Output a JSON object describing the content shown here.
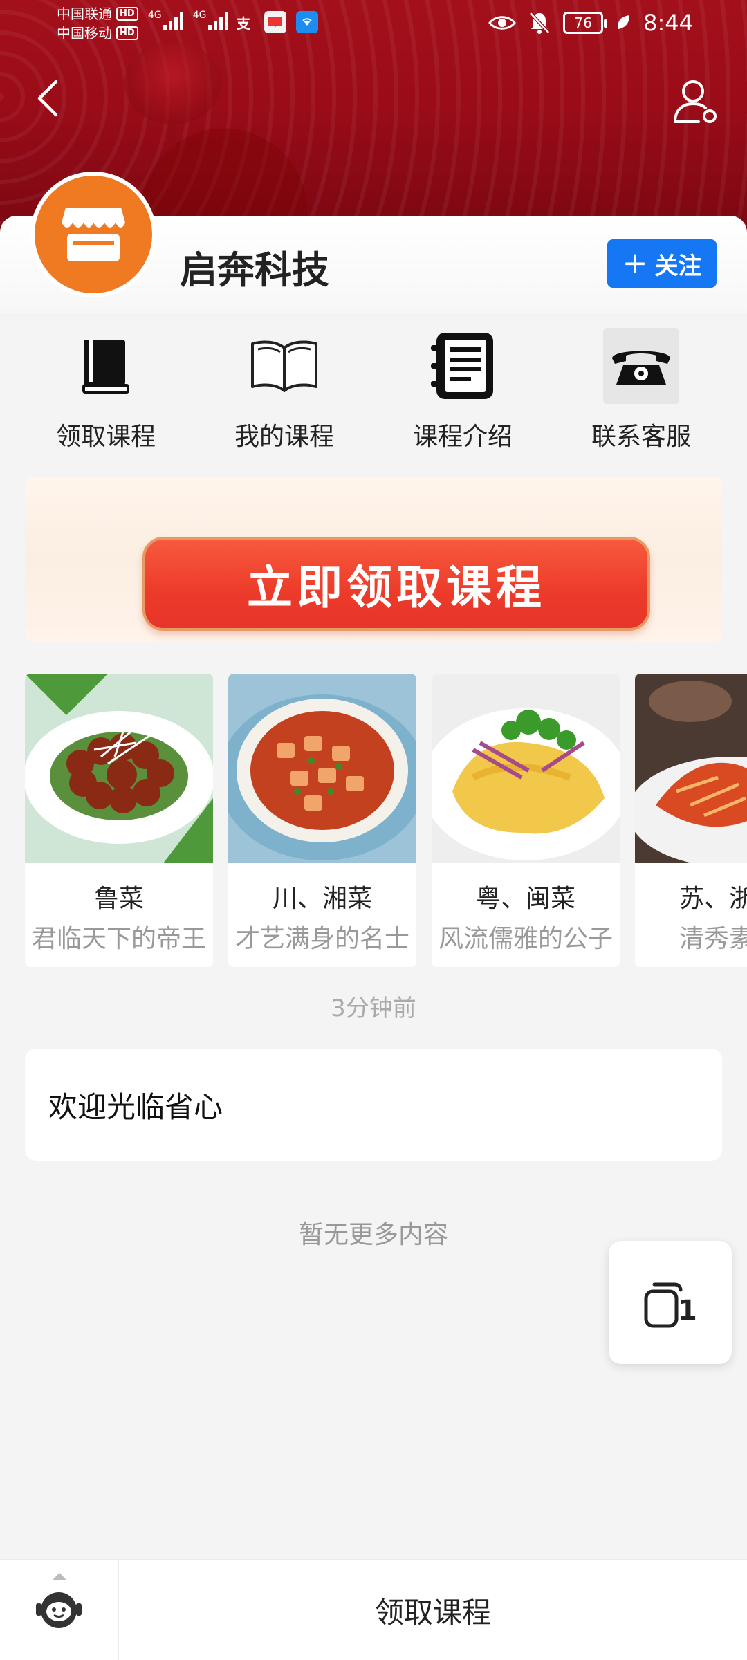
{
  "status_bar": {
    "carrier_1": "中国联通",
    "carrier_2": "中国移动",
    "hd_badge": "HD",
    "network_type": "4G",
    "battery_level": "76",
    "time": "8:44"
  },
  "header": {
    "back_icon": "chevron-left-icon",
    "profile_icon": "user-settings-icon"
  },
  "store": {
    "name": "启奔科技",
    "logo_icon": "storefront-icon",
    "logo_color": "#f07a22",
    "follow_plus": "+",
    "follow_label": "关注",
    "follow_color": "#1677f5"
  },
  "quick_menu": [
    {
      "label": "领取课程",
      "icon": "book-icon"
    },
    {
      "label": "我的课程",
      "icon": "open-book-icon"
    },
    {
      "label": "课程介绍",
      "icon": "notebook-icon"
    },
    {
      "label": "联系客服",
      "icon": "telephone-icon"
    }
  ],
  "banner": {
    "button_label": "立即领取课程"
  },
  "cuisines": [
    {
      "title": "鲁菜",
      "subtitle": "君临天下的帝王"
    },
    {
      "title": "川、湘菜",
      "subtitle": "才艺满身的名士"
    },
    {
      "title": "粤、闽菜",
      "subtitle": "风流儒雅的公子"
    },
    {
      "title": "苏、浙、",
      "subtitle": "清秀素丽"
    }
  ],
  "feed": {
    "timestamp": "3分钟前",
    "message": "欢迎光临省心",
    "no_more": "暂无更多内容"
  },
  "floating_button": {
    "icon": "copy-icon",
    "count": "1"
  },
  "bottom_bar": {
    "assistant_icon": "robot-assistant-icon",
    "claim_label": "领取课程"
  }
}
